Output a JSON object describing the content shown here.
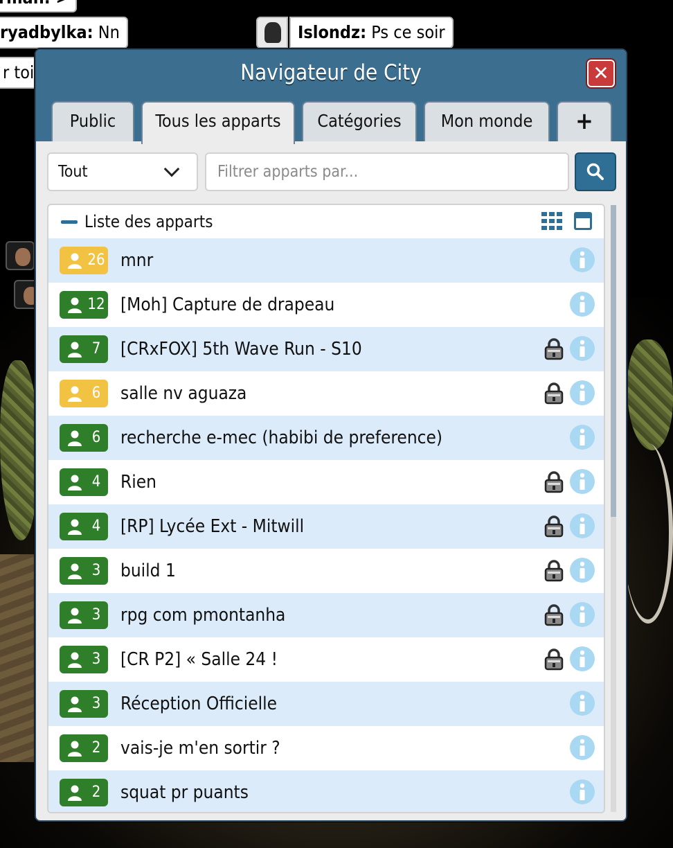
{
  "chat": {
    "bubble1": "rman: >",
    "bubble2_user": "ryadbylka:",
    "bubble2_text": "Nn",
    "bubble3_user": "Islondz:",
    "bubble3_text": "Ps ce soir",
    "bubble4": "r toi"
  },
  "window": {
    "title": "Navigateur de City",
    "close_label": "✕"
  },
  "tabs": [
    {
      "label": "Public"
    },
    {
      "label": "Tous les apparts"
    },
    {
      "label": "Catégories"
    },
    {
      "label": "Mon monde"
    },
    {
      "label": "+"
    }
  ],
  "active_tab": "Tous les apparts",
  "filter": {
    "selected": "Tout",
    "search_placeholder": "Filtrer apparts par..."
  },
  "list": {
    "title": "Liste des apparts",
    "rooms": [
      {
        "count": "26",
        "name": "mnr",
        "badge": "yellow",
        "locked": false
      },
      {
        "count": "12",
        "name": "[Moh] Capture de drapeau",
        "badge": "green",
        "locked": false
      },
      {
        "count": "7",
        "name": "[CRxFOX] 5th Wave Run - S10",
        "badge": "green",
        "locked": true
      },
      {
        "count": "6",
        "name": "salle nv aguaza",
        "badge": "yellow",
        "locked": true
      },
      {
        "count": "6",
        "name": "recherche e-mec (habibi de preference)",
        "badge": "green",
        "locked": false
      },
      {
        "count": "4",
        "name": "Rien",
        "badge": "green",
        "locked": true
      },
      {
        "count": "4",
        "name": "[RP] Lycée Ext - Mitwill",
        "badge": "green",
        "locked": true
      },
      {
        "count": "3",
        "name": "build 1",
        "badge": "green",
        "locked": true
      },
      {
        "count": "3",
        "name": "rpg com pmontanha",
        "badge": "green",
        "locked": true
      },
      {
        "count": "3",
        "name": "[CR P2] « Salle 24 !",
        "badge": "green",
        "locked": true
      },
      {
        "count": "3",
        "name": "Réception Officielle",
        "badge": "green",
        "locked": false
      },
      {
        "count": "2",
        "name": "vais-je m'en sortir ?",
        "badge": "green",
        "locked": false
      },
      {
        "count": "2",
        "name": "squat pr puants",
        "badge": "green",
        "locked": false
      }
    ]
  },
  "colors": {
    "header": "#3c6e8f",
    "badge_green": "#2f7e2a",
    "badge_yellow": "#f2c343",
    "row_alt": "#dcebfa",
    "close_red": "#c93a3a",
    "info_blue": "#a9d8f2"
  }
}
